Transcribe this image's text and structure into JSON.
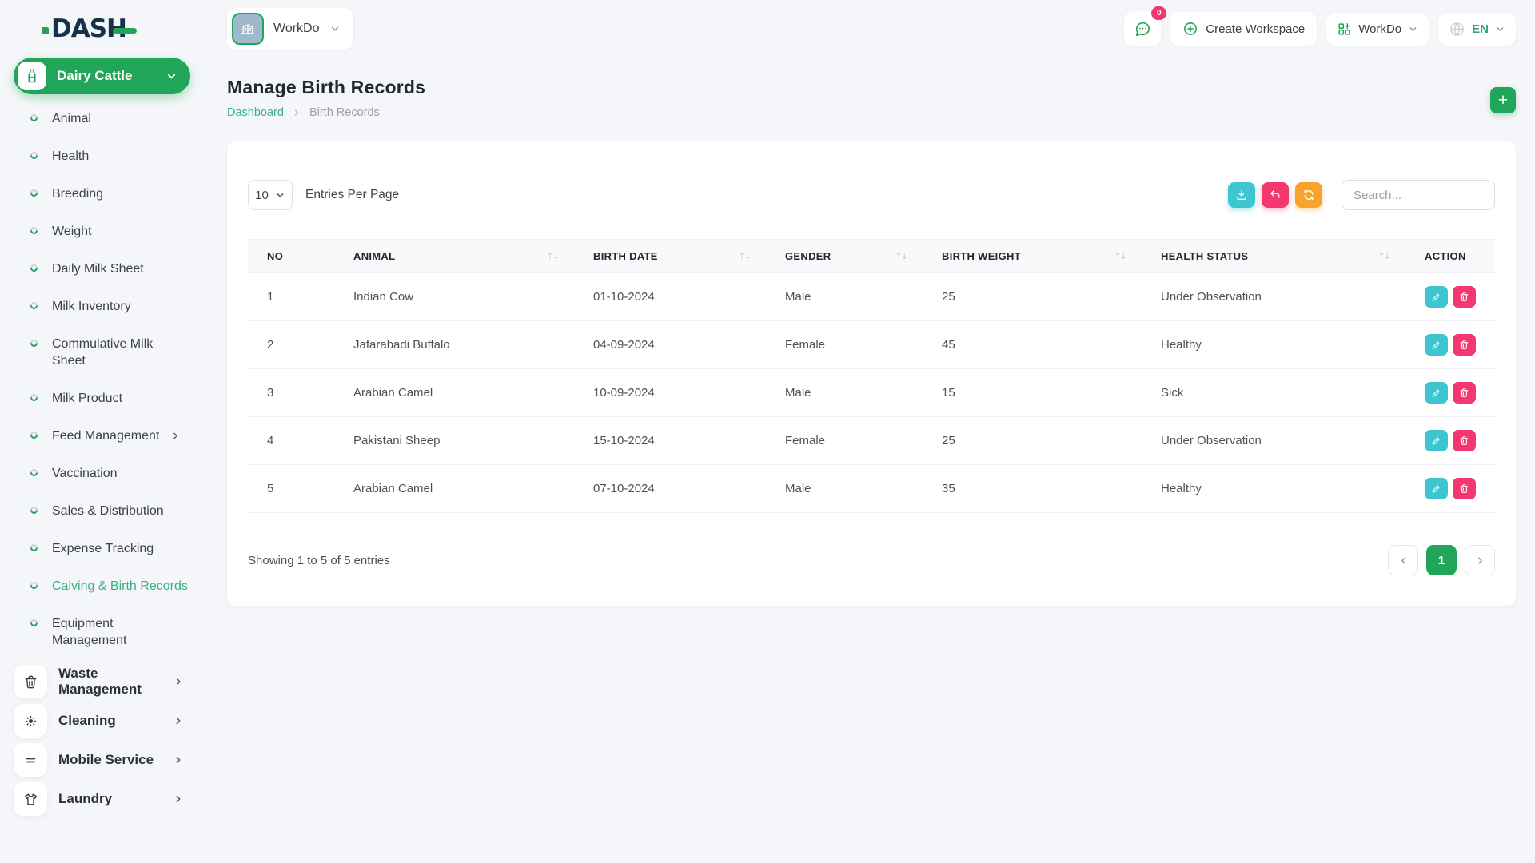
{
  "brand": {
    "logo_text": "DASH"
  },
  "topbar": {
    "workspace_chip_label": "WorkDo",
    "messages_badge": "0",
    "create_workspace_label": "Create Workspace",
    "apps_menu_label": "WorkDo",
    "language_code": "EN"
  },
  "sidebar": {
    "section_title": "Dairy Cattle",
    "items": [
      {
        "label": "Animal"
      },
      {
        "label": "Health"
      },
      {
        "label": "Breeding"
      },
      {
        "label": "Weight"
      },
      {
        "label": "Daily Milk Sheet"
      },
      {
        "label": "Milk Inventory"
      },
      {
        "label": "Commulative Milk Sheet"
      },
      {
        "label": "Milk Product"
      },
      {
        "label": "Feed Management"
      },
      {
        "label": "Vaccination"
      },
      {
        "label": "Sales & Distribution"
      },
      {
        "label": "Expense Tracking"
      },
      {
        "label": "Calving & Birth Records"
      },
      {
        "label": "Equipment Management"
      }
    ],
    "modules": [
      {
        "label": "Waste Management",
        "icon": "trash-icon"
      },
      {
        "label": "Cleaning",
        "icon": "brightness-icon"
      },
      {
        "label": "Mobile Service",
        "icon": "menu-lines-icon"
      },
      {
        "label": "Laundry",
        "icon": "tshirt-icon"
      }
    ]
  },
  "page": {
    "title": "Manage Birth Records",
    "breadcrumb_home": "Dashboard",
    "breadcrumb_current": "Birth Records"
  },
  "toolbar": {
    "entries_per_page_value": "10",
    "entries_per_page_label": "Entries Per Page",
    "search_placeholder": "Search..."
  },
  "table": {
    "columns": [
      "NO",
      "ANIMAL",
      "BIRTH DATE",
      "GENDER",
      "BIRTH WEIGHT",
      "HEALTH STATUS",
      "ACTION"
    ],
    "rows": [
      {
        "no": "1",
        "animal": "Indian Cow",
        "birth_date": "01-10-2024",
        "gender": "Male",
        "birth_weight": "25",
        "health_status": "Under Observation"
      },
      {
        "no": "2",
        "animal": "Jafarabadi Buffalo",
        "birth_date": "04-09-2024",
        "gender": "Female",
        "birth_weight": "45",
        "health_status": "Healthy"
      },
      {
        "no": "3",
        "animal": "Arabian Camel",
        "birth_date": "10-09-2024",
        "gender": "Male",
        "birth_weight": "15",
        "health_status": "Sick"
      },
      {
        "no": "4",
        "animal": "Pakistani Sheep",
        "birth_date": "15-10-2024",
        "gender": "Female",
        "birth_weight": "25",
        "health_status": "Under Observation"
      },
      {
        "no": "5",
        "animal": "Arabian Camel",
        "birth_date": "07-10-2024",
        "gender": "Male",
        "birth_weight": "35",
        "health_status": "Healthy"
      }
    ]
  },
  "footer": {
    "summary": "Showing 1 to 5 of 5 entries",
    "current_page": "1"
  },
  "colors": {
    "primary_green": "#21a558",
    "link_green": "#35b384",
    "teal": "#3dc5d2",
    "pink": "#f2386f",
    "orange": "#f7a42c",
    "logo_navy": "#15314b"
  },
  "icons": {
    "sort_glyph": "↑↓",
    "plus_glyph": "+",
    "names": [
      "chat-icon",
      "plus-circle-icon",
      "grid-icon",
      "globe-icon",
      "chevron-down-icon",
      "chevron-right-icon",
      "chevron-left-icon",
      "milk-bottle-icon",
      "building-icon",
      "download-icon",
      "undo-icon",
      "refresh-icon",
      "edit-icon",
      "delete-icon",
      "trash-icon",
      "brightness-icon",
      "menu-lines-icon",
      "tshirt-icon"
    ]
  }
}
